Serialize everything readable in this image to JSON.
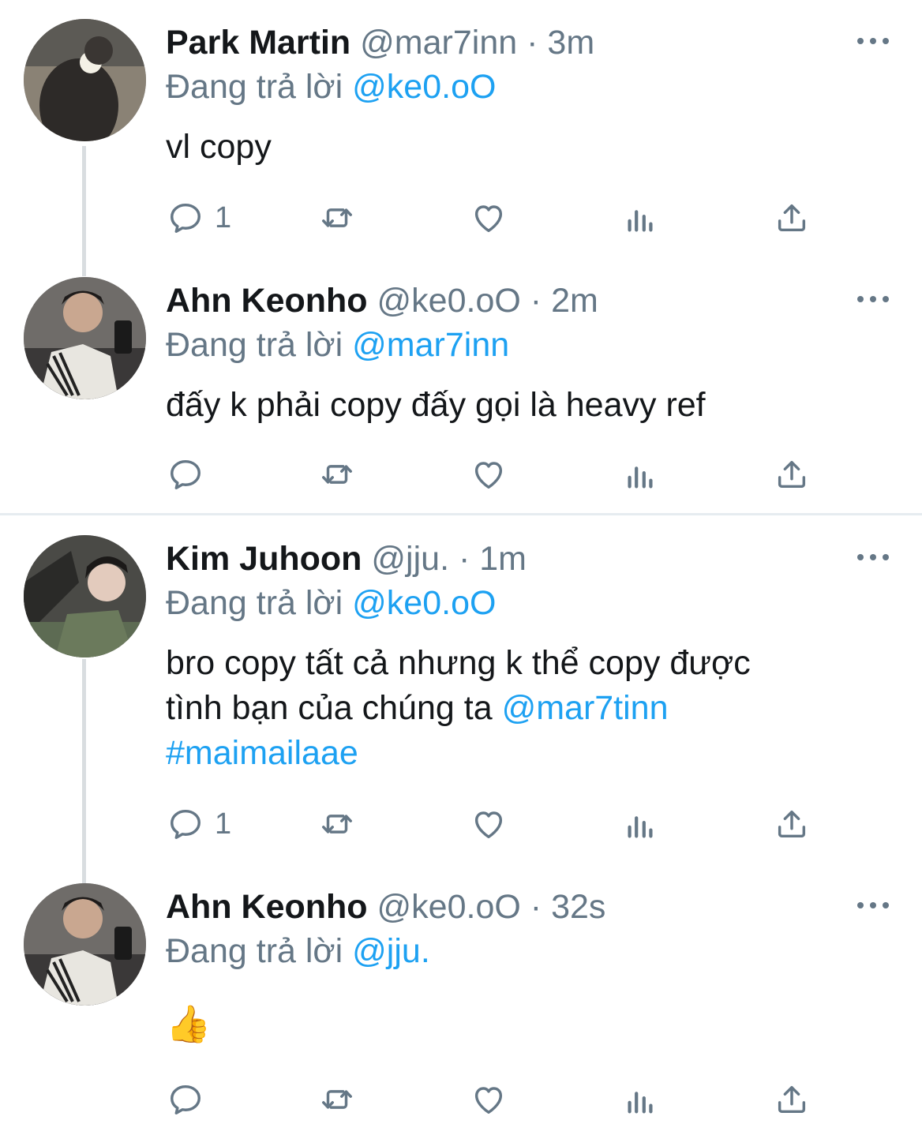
{
  "colors": {
    "link": "#1da1f2",
    "muted": "#657786",
    "text": "#14171a",
    "divider": "#e6ecf0"
  },
  "tweets": [
    {
      "name": "Park Martin",
      "handle": "@mar7inn",
      "dot": "·",
      "time": "3m",
      "reply_prefix": "Đang trả lời",
      "reply_to": "@ke0.oO",
      "text": "vl copy",
      "reply_count": "1"
    },
    {
      "name": "Ahn Keonho",
      "handle": "@ke0.oO",
      "dot": "·",
      "time": "2m",
      "reply_prefix": "Đang trả lời",
      "reply_to": "@mar7inn",
      "text": "đấy k phải copy đấy gọi là heavy ref",
      "reply_count": ""
    },
    {
      "name": "Kim Juhoon",
      "handle": "@jju.",
      "dot": "·",
      "time": "1m",
      "reply_prefix": "Đang trả lời",
      "reply_to": "@ke0.oO",
      "text_line1": "bro copy tất cả nhưng k thể copy được",
      "text_line2": "tình bạn của chúng ta",
      "mention": "@mar7tinn",
      "hashtag": "#maimailaae",
      "reply_count": "1"
    },
    {
      "name": "Ahn Keonho",
      "handle": "@ke0.oO",
      "dot": "·",
      "time": "32s",
      "reply_prefix": "Đang trả lời",
      "reply_to": "@jju.",
      "text": "👍",
      "reply_count": ""
    }
  ],
  "icons": {
    "reply": "reply-icon",
    "retweet": "retweet-icon",
    "like": "heart-icon",
    "analytics": "analytics-icon",
    "share": "share-icon",
    "more": "more-icon"
  }
}
